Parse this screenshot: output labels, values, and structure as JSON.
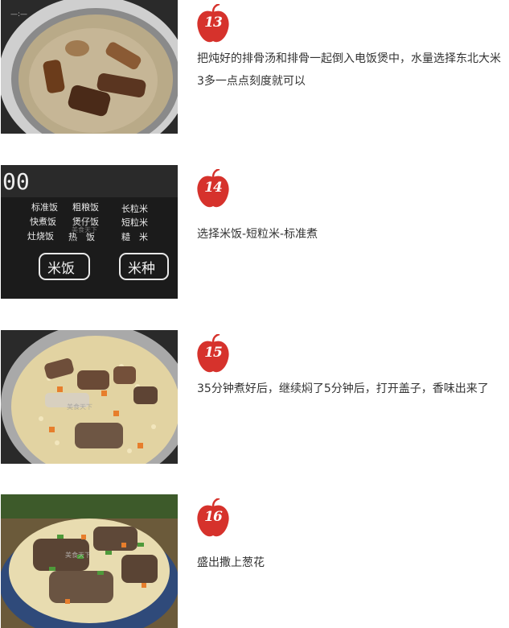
{
  "steps": [
    {
      "number": "13",
      "text": "把炖好的排骨汤和排骨一起倒入电饭煲中，水量选择东北大米3多一点点刻度就可以"
    },
    {
      "number": "14",
      "text": "选择米饭-短粒米-标准煮",
      "panel": {
        "display": "00",
        "menu_row1": [
          "标准饭",
          "粗粮饭",
          "长粒米"
        ],
        "menu_row2": [
          "快煮饭",
          "煲仔饭",
          "短粒米"
        ],
        "menu_row3": [
          "灶烧饭",
          "热　饭",
          "糙　米"
        ],
        "button_left": "米饭",
        "button_right": "米种"
      }
    },
    {
      "number": "15",
      "text": "35分钟煮好后，继续焖了5分钟后，打开盖子，香味出来了"
    },
    {
      "number": "16",
      "text": "盛出撒上葱花"
    }
  ],
  "watermark": "美食天下",
  "colors": {
    "badge_red": "#d6322c",
    "text": "#333333"
  }
}
